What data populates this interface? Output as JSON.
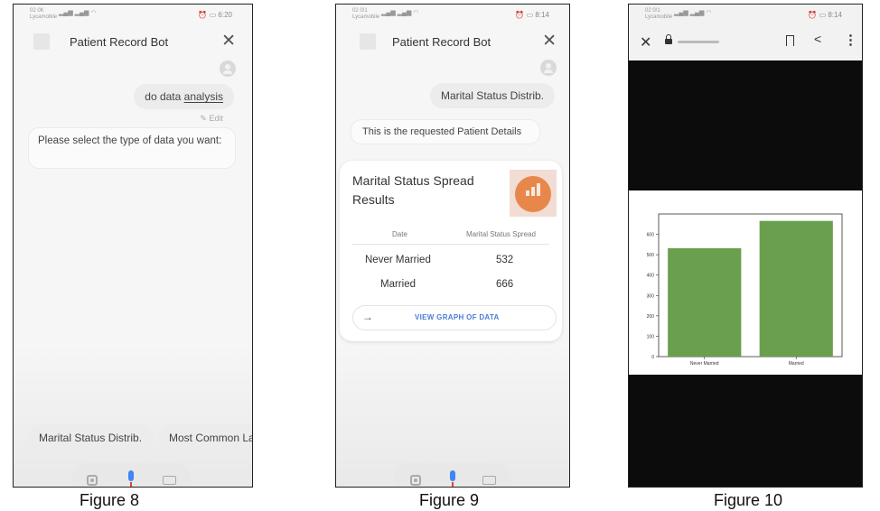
{
  "figures": [
    {
      "caption": "Figure 8",
      "status": {
        "carrier_line1": "02 0K",
        "carrier_line2": "Lycamobile",
        "time": "6:20"
      },
      "appbar": {
        "title": "Patient Record Bot"
      },
      "user_message": {
        "text_prefix": "do data ",
        "text_underlined": "analysis"
      },
      "edit_label": "Edit",
      "bot_message": "Please select the type of data you want:",
      "suggestion_chips": [
        "Marital Status Distrib.",
        "Most Common La"
      ]
    },
    {
      "caption": "Figure 9",
      "status": {
        "carrier_line1": "02 0/1",
        "carrier_line2": "Lycamobile",
        "time": "8:14"
      },
      "appbar": {
        "title": "Patient Record Bot"
      },
      "user_message": "Marital Status Distrib.",
      "bot_message": "This is the requested Patient Details",
      "card": {
        "title": "Marital Status Spread Results",
        "columns": [
          "Date",
          "Marital Status Spread"
        ],
        "rows": [
          [
            "Never Married",
            "532"
          ],
          [
            "Married",
            "666"
          ]
        ],
        "cta_label": "VIEW GRAPH OF DATA"
      }
    },
    {
      "caption": "Figure 10",
      "status": {
        "carrier_line1": "02 0/1",
        "carrier_line2": "Lycamobile",
        "time": "8:14"
      }
    }
  ],
  "colors": {
    "bar": "#6a9f4e",
    "accent": "#4c7cd6",
    "mic_blue": "#4285f4",
    "mic_red": "#e94235",
    "thumb_orange": "#e8874a"
  },
  "icons": [
    "close-icon",
    "avatar-icon",
    "pencil-icon",
    "lens-icon",
    "mic-icon",
    "keyboard-icon",
    "arrow-right-icon",
    "lock-icon",
    "bookmark-icon",
    "share-icon",
    "more-vert-icon",
    "alarm-icon",
    "battery-icon",
    "signal-icon",
    "wifi-icon"
  ],
  "chart_data": {
    "type": "bar",
    "categories": [
      "Never Married",
      "Married"
    ],
    "values": [
      532,
      666
    ],
    "ylim": [
      0,
      700
    ],
    "yticks": [
      0,
      100,
      200,
      300,
      400,
      500,
      600
    ],
    "grid": false,
    "title": "",
    "xlabel": "",
    "ylabel": ""
  }
}
